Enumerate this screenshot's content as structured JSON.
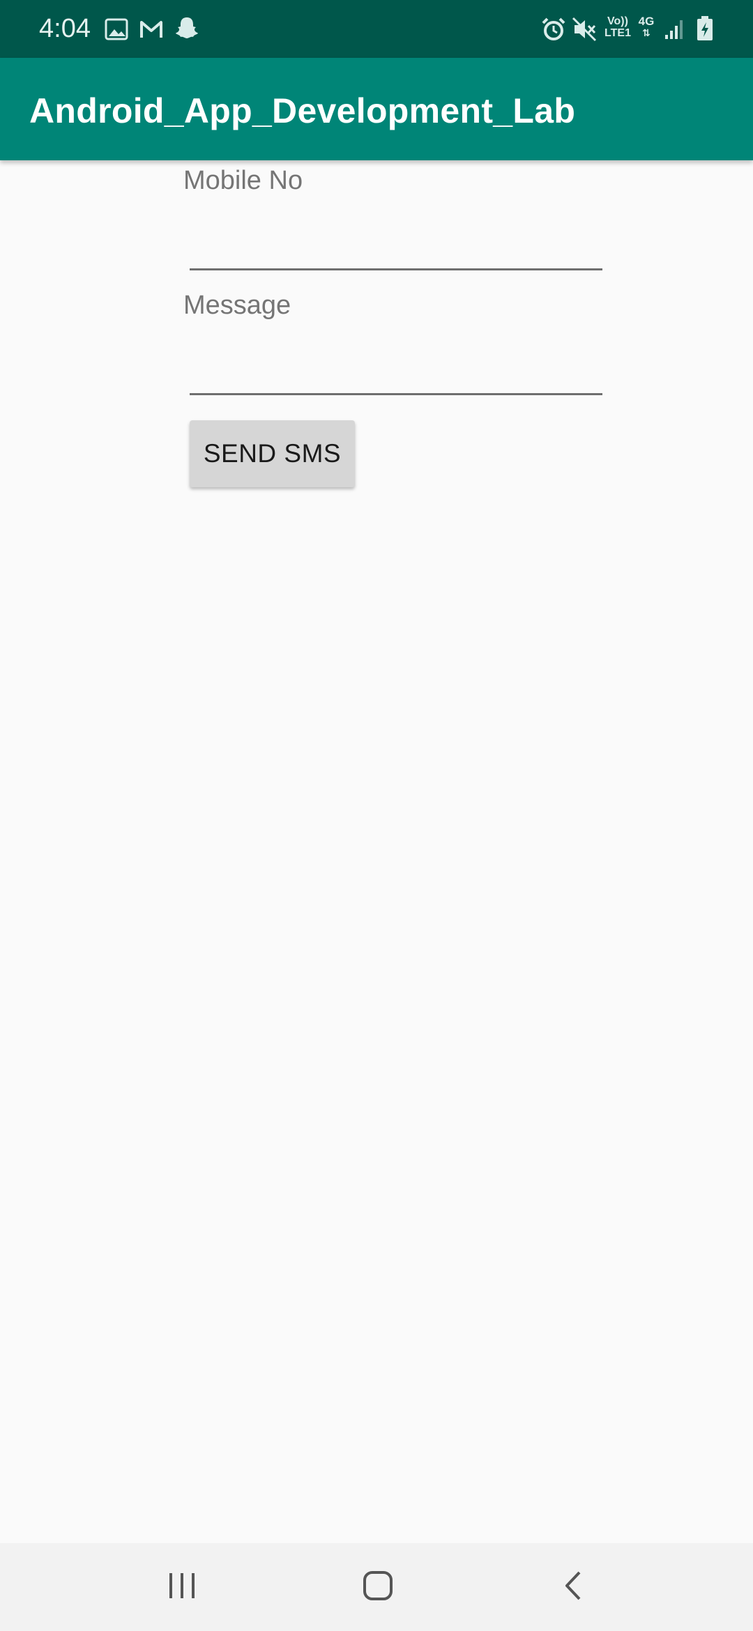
{
  "status_bar": {
    "time": "4:04",
    "left_icons": [
      "gallery-icon",
      "gmail-icon",
      "snapchat-icon"
    ],
    "right_icons": [
      "alarm-icon",
      "vibrate-icon",
      "volte-icon",
      "4g-icon",
      "signal-icon",
      "battery-charging-icon"
    ],
    "volte_label_top": "Vo))",
    "volte_label_bottom": "LTE1",
    "network_label": "4G",
    "background_color": "#00574b"
  },
  "app_bar": {
    "title": "Android_App_Development_Lab",
    "background_color": "#008577"
  },
  "form": {
    "mobile_label": "Mobile No",
    "mobile_value": "",
    "message_label": "Message",
    "message_value": "",
    "send_button_label": "SEND SMS"
  },
  "nav_bar": {
    "buttons": [
      "recent-apps-icon",
      "home-icon",
      "back-icon"
    ]
  }
}
